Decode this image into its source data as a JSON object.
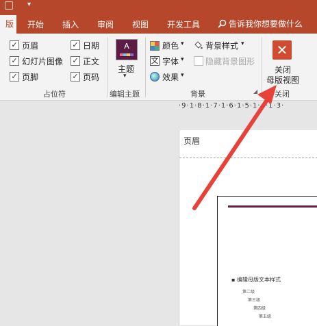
{
  "title_bar": {
    "undo_glyph": "▾"
  },
  "tabs": [
    {
      "label": "版"
    },
    {
      "label": "开始"
    },
    {
      "label": "插入"
    },
    {
      "label": "审阅"
    },
    {
      "label": "视图"
    },
    {
      "label": "开发工具"
    }
  ],
  "tell_me": "告诉我你想要做什么",
  "placeholders_group": {
    "label": "占位符",
    "items": [
      {
        "label": "页眉",
        "checked": true
      },
      {
        "label": "日期",
        "checked": true
      },
      {
        "label": "幻灯片图像",
        "checked": true
      },
      {
        "label": "正文",
        "checked": true
      },
      {
        "label": "页脚",
        "checked": true
      },
      {
        "label": "页码",
        "checked": true
      }
    ]
  },
  "edit_theme_group": {
    "label": "编辑主题",
    "theme_button": "主题",
    "theme_glyph": "A"
  },
  "background_group": {
    "label": "背景",
    "colors": "颜色",
    "fonts": "字体",
    "effects": "效果",
    "bg_styles": "背景样式",
    "hide_bg": "隐藏背景图形",
    "font_glyph": "文"
  },
  "close_group": {
    "label": "关闭",
    "button_line1": "关闭",
    "button_line2": "母版视图",
    "close_glyph": "✕"
  },
  "ruler": "·9·1·8·1·7·1·6·1·5·1·4·1·3·",
  "document": {
    "header_label": "页眉",
    "body_text": "编辑母版文本样式",
    "level2": "第二级",
    "level3": "第三级",
    "level4": "第四级",
    "level5": "第五级"
  },
  "colors": {
    "accent": "#b7472a",
    "close_red": "#d14b32",
    "arrow": "#e8413a"
  }
}
